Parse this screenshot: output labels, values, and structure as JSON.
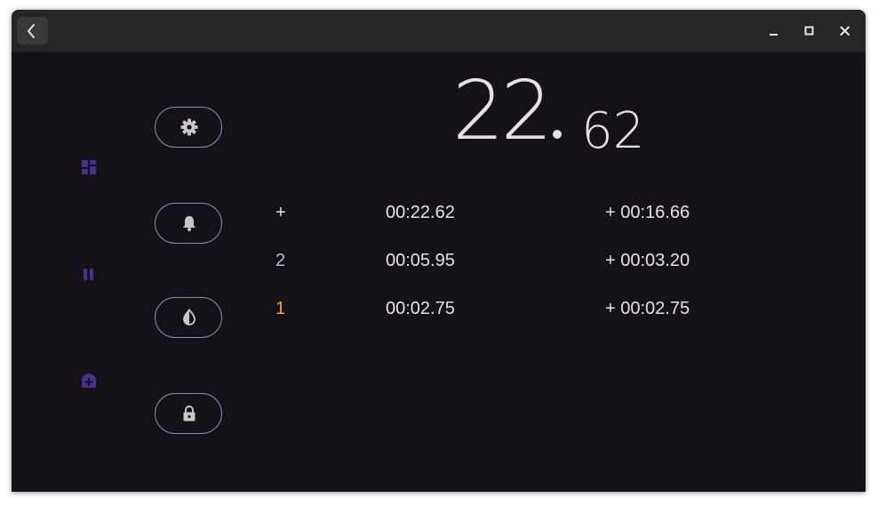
{
  "window": {
    "titlebar": {
      "back_icon": "chevron-left-icon",
      "minimize_icon": "minimize-icon",
      "maximize_icon": "maximize-icon",
      "close_icon": "close-icon"
    }
  },
  "rail": {
    "items": [
      {
        "icon": "dashboard-icon"
      },
      {
        "icon": "pause-icon"
      },
      {
        "icon": "add-alarm-icon"
      }
    ],
    "accent_color": "#4a2f8f"
  },
  "side_buttons": [
    {
      "icon": "gear-icon"
    },
    {
      "icon": "bell-icon"
    },
    {
      "icon": "contrast-icon"
    },
    {
      "icon": "lock-icon"
    }
  ],
  "stopwatch": {
    "main": "22",
    "fraction": "62"
  },
  "laps": [
    {
      "number": "+",
      "time": "00:22.62",
      "diff": "+ 00:16.66"
    },
    {
      "number": "2",
      "time": "00:05.95",
      "diff": "+ 00:03.20"
    },
    {
      "number": "1",
      "time": "00:02.75",
      "diff": "+ 00:02.75"
    }
  ],
  "colors": {
    "background": "#141218",
    "text": "#e6e1e5",
    "best_lap": "#f5a623",
    "outline": "#938f99"
  }
}
